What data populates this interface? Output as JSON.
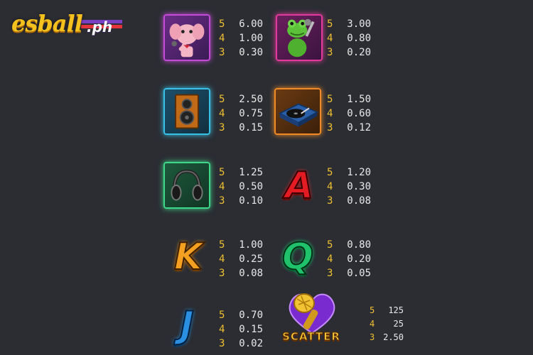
{
  "logo": {
    "text": "esball",
    "suffix": ".ph"
  },
  "colors": {
    "background": "#2b2d33",
    "count": "#f0c030",
    "value": "#e9e9e9"
  },
  "symbols": [
    {
      "icon": "elephant-icon",
      "pays": [
        {
          "count": "5",
          "value": "6.00"
        },
        {
          "count": "4",
          "value": "1.00"
        },
        {
          "count": "3",
          "value": "0.30"
        }
      ]
    },
    {
      "icon": "frog-icon",
      "pays": [
        {
          "count": "5",
          "value": "3.00"
        },
        {
          "count": "4",
          "value": "0.80"
        },
        {
          "count": "3",
          "value": "0.20"
        }
      ]
    },
    {
      "icon": "speaker-icon",
      "pays": [
        {
          "count": "5",
          "value": "2.50"
        },
        {
          "count": "4",
          "value": "0.75"
        },
        {
          "count": "3",
          "value": "0.15"
        }
      ]
    },
    {
      "icon": "turntable-icon",
      "pays": [
        {
          "count": "5",
          "value": "1.50"
        },
        {
          "count": "4",
          "value": "0.60"
        },
        {
          "count": "3",
          "value": "0.12"
        }
      ]
    },
    {
      "icon": "headphones-icon",
      "pays": [
        {
          "count": "5",
          "value": "1.25"
        },
        {
          "count": "4",
          "value": "0.50"
        },
        {
          "count": "3",
          "value": "0.10"
        }
      ]
    },
    {
      "icon": "letter-a-icon",
      "label": "A",
      "pays": [
        {
          "count": "5",
          "value": "1.20"
        },
        {
          "count": "4",
          "value": "0.30"
        },
        {
          "count": "3",
          "value": "0.08"
        }
      ]
    },
    {
      "icon": "letter-k-icon",
      "label": "K",
      "pays": [
        {
          "count": "5",
          "value": "1.00"
        },
        {
          "count": "4",
          "value": "0.25"
        },
        {
          "count": "3",
          "value": "0.08"
        }
      ]
    },
    {
      "icon": "letter-q-icon",
      "label": "Q",
      "pays": [
        {
          "count": "5",
          "value": "0.80"
        },
        {
          "count": "4",
          "value": "0.20"
        },
        {
          "count": "3",
          "value": "0.05"
        }
      ]
    },
    {
      "icon": "letter-j-icon",
      "label": "J",
      "pays": [
        {
          "count": "5",
          "value": "0.70"
        },
        {
          "count": "4",
          "value": "0.15"
        },
        {
          "count": "3",
          "value": "0.02"
        }
      ]
    },
    {
      "icon": "microphone-icon",
      "label": "SCATTER",
      "pays": [
        {
          "count": "5",
          "value": "125"
        },
        {
          "count": "4",
          "value": "25"
        },
        {
          "count": "3",
          "value": "2.50"
        }
      ]
    }
  ]
}
